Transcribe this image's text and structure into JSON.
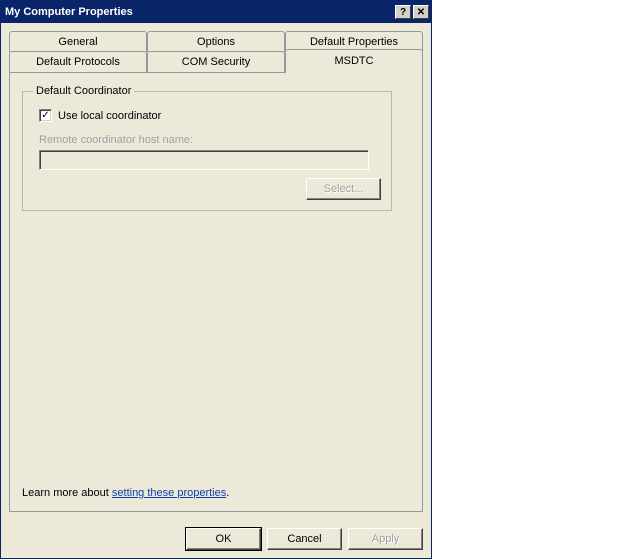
{
  "window": {
    "title": "My Computer Properties",
    "help_glyph": "?",
    "close_glyph": "✕"
  },
  "tabs": {
    "row_back": [
      {
        "label": "General"
      },
      {
        "label": "Options"
      },
      {
        "label": "Default Properties"
      }
    ],
    "row_front": [
      {
        "label": "Default Protocols"
      },
      {
        "label": "COM Security"
      },
      {
        "label": "MSDTC",
        "active": true
      }
    ]
  },
  "groupbox": {
    "legend": "Default Coordinator",
    "checkbox_label": "Use local coordinator",
    "checkbox_checked": true,
    "remote_label": "Remote coordinator host name:",
    "remote_value": "",
    "select_button": "Select..."
  },
  "learn_more": {
    "prefix": "Learn more about ",
    "link": "setting these properties",
    "suffix": "."
  },
  "buttons": {
    "ok": "OK",
    "cancel": "Cancel",
    "apply": "Apply"
  }
}
